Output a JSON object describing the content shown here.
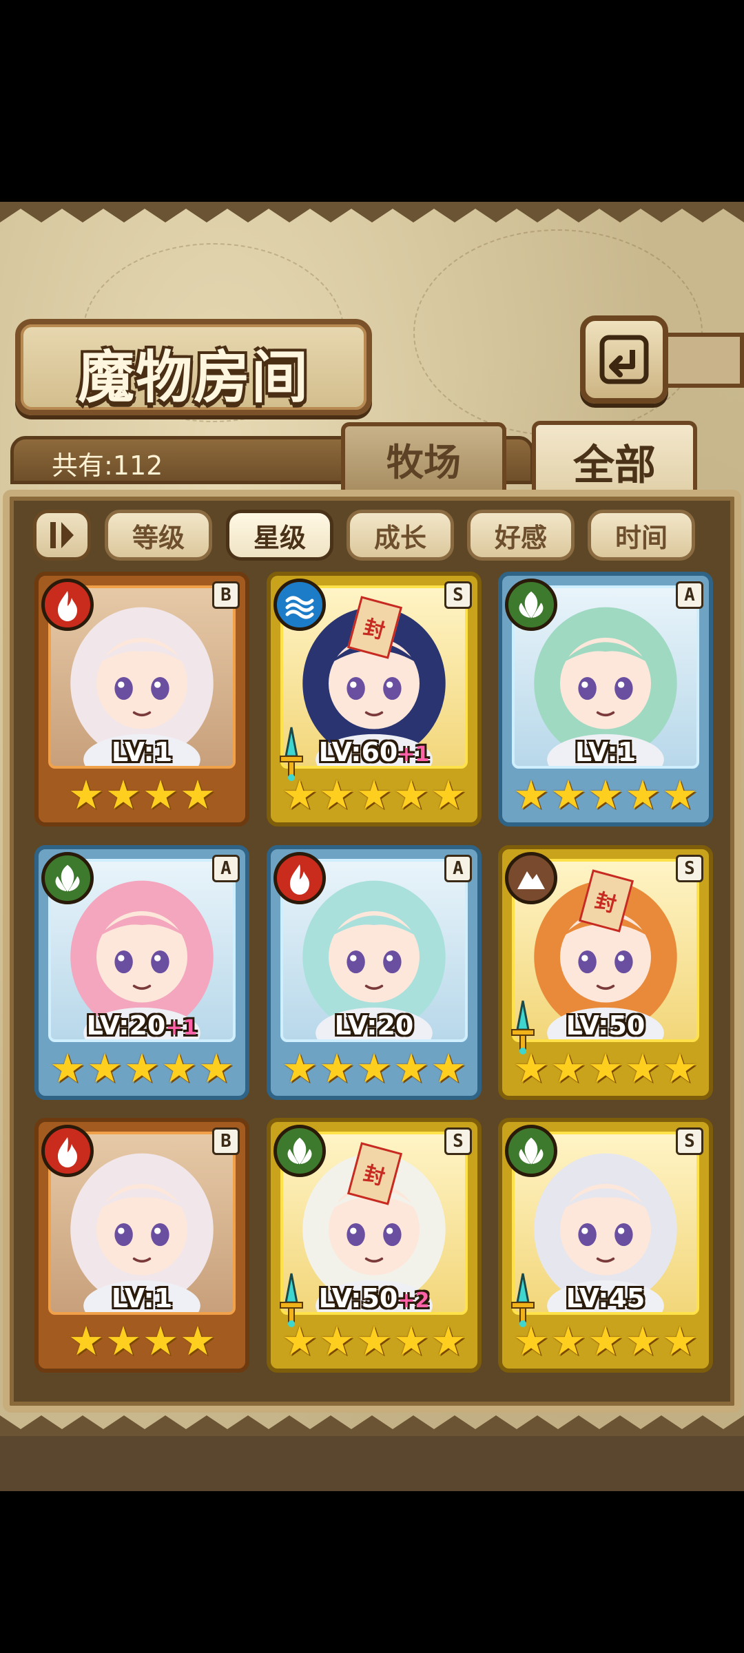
{
  "title": "魔物房间",
  "count_label": "共有:112",
  "tabs": [
    {
      "label": "牧场",
      "active": false
    },
    {
      "label": "全部",
      "active": true
    }
  ],
  "filters": [
    {
      "label": "等级",
      "active": false
    },
    {
      "label": "星级",
      "active": true
    },
    {
      "label": "成长",
      "active": false
    },
    {
      "label": "好感",
      "active": false
    },
    {
      "label": "时间",
      "active": false
    }
  ],
  "cards": [
    {
      "element": "fire",
      "rank": "B",
      "lv": "LV:1",
      "plus": "",
      "stars": 4,
      "frame": "bronze",
      "weapon": false,
      "seal": false,
      "hair": "#f1e6ea"
    },
    {
      "element": "water",
      "rank": "S",
      "lv": "LV:60",
      "plus": "+1",
      "stars": 5,
      "frame": "gold",
      "weapon": true,
      "seal": true,
      "seal_text": "封",
      "hair": "#2a3470"
    },
    {
      "element": "leaf",
      "rank": "A",
      "lv": "LV:1",
      "plus": "",
      "stars": 5,
      "frame": "blue",
      "weapon": false,
      "seal": false,
      "hair": "#9fd9c2"
    },
    {
      "element": "leaf",
      "rank": "A",
      "lv": "LV:20",
      "plus": "+1",
      "stars": 5,
      "frame": "blue",
      "weapon": false,
      "seal": false,
      "hair": "#f3a6bd"
    },
    {
      "element": "fire",
      "rank": "A",
      "lv": "LV:20",
      "plus": "",
      "stars": 5,
      "frame": "blue",
      "weapon": false,
      "seal": false,
      "hair": "#a9e0dc"
    },
    {
      "element": "earth",
      "rank": "S",
      "lv": "LV:50",
      "plus": "",
      "stars": 5,
      "frame": "gold",
      "weapon": true,
      "seal": true,
      "seal_text": "封",
      "hair": "#e98a3a"
    },
    {
      "element": "fire",
      "rank": "B",
      "lv": "LV:1",
      "plus": "",
      "stars": 4,
      "frame": "bronze",
      "weapon": false,
      "seal": false,
      "hair": "#f1e6ea"
    },
    {
      "element": "leaf",
      "rank": "S",
      "lv": "LV:50",
      "plus": "+2",
      "stars": 5,
      "frame": "gold",
      "weapon": true,
      "seal": true,
      "seal_text": "封",
      "hair": "#f2f2ea"
    },
    {
      "element": "leaf",
      "rank": "S",
      "lv": "LV:45",
      "plus": "",
      "stars": 5,
      "frame": "gold",
      "weapon": true,
      "seal": false,
      "hair": "#e6e6ee"
    }
  ]
}
